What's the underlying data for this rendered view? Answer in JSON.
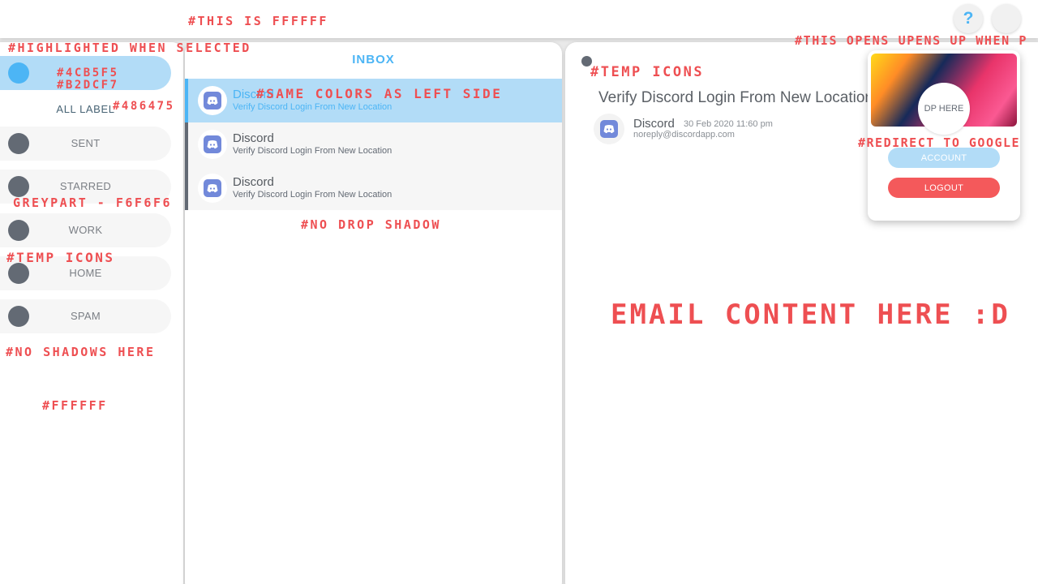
{
  "colors": {
    "accent": "#4cb5f5",
    "highlight": "#b2dcf7",
    "label_text": "#486475",
    "grey_part": "#f6f6f6",
    "icon_grey": "#636a74",
    "logout": "#f4595b",
    "annotation": "#ee4f52",
    "discord": "#7289da"
  },
  "topbar": {
    "help_label": "?"
  },
  "sidebar": {
    "all_label": "ALL LABEL",
    "items": [
      {
        "label": "",
        "selected": true,
        "icon": "circle-icon"
      },
      {
        "label": "SENT",
        "icon": "circle-icon"
      },
      {
        "label": "STARRED",
        "icon": "circle-icon"
      },
      {
        "label": "WORK",
        "icon": "circle-icon"
      },
      {
        "label": "HOME",
        "icon": "circle-icon"
      },
      {
        "label": "SPAM",
        "icon": "circle-icon"
      }
    ]
  },
  "inbox": {
    "title": "INBOX",
    "mails": [
      {
        "sender": "Discord",
        "subject": "Verify Discord Login From New Location",
        "selected": true,
        "icon": "discord-icon"
      },
      {
        "sender": "Discord",
        "subject": "Verify Discord Login From New Location",
        "icon": "discord-icon"
      },
      {
        "sender": "Discord",
        "subject": "Verify Discord Login From New Location",
        "icon": "discord-icon"
      }
    ]
  },
  "reader": {
    "subject": "Verify Discord Login From New Location",
    "sender": "Discord",
    "date": "30 Feb 2020 11:60 pm",
    "email": "noreply@discordapp.com"
  },
  "profile_popup": {
    "dp_label": "DP HERE",
    "account_label": "ACCOUNT",
    "logout_label": "LOGOUT"
  },
  "annotations": {
    "this_is_ffffff": "#THIS IS FFFFFF",
    "highlighted_when_selected": "#HIGHLIGHTED WHEN SELECTED",
    "color_4cb5f5": "#4CB5F5",
    "color_b2dcf7": "#B2DCF7",
    "color_486475": "#486475",
    "grey_part": "GREYPART - F6F6F6",
    "temp_icons_left": "#TEMP ICONS",
    "no_shadows_here": "#NO SHADOWS HERE",
    "ffffff_sidebar": "#FFFFFF",
    "same_colors": "#SAME COLORS AS LEFT SIDE",
    "no_drop_shadow": "#NO DROP SHADOW",
    "temp_icons_right": "#TEMP ICONS",
    "opens_up": "#THIS OPENS UPENS UP WHEN P",
    "redirect_google": "#REDIRECT TO GOOGLE",
    "email_content_here": "EMAIL CONTENT HERE :D"
  }
}
